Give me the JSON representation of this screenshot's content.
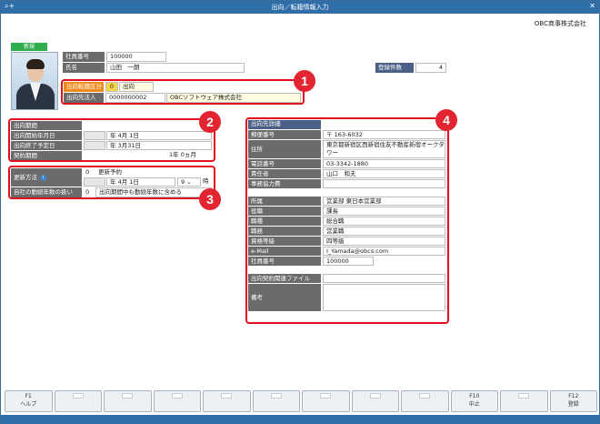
{
  "window": {
    "title": "出向／転籍情報入力",
    "company": "OBC商事株式会社"
  },
  "employee": {
    "badge": "新規",
    "id_label": "社員番号",
    "id_value": "100000",
    "name_label": "氏名",
    "name_value": "山田　一朗"
  },
  "registered": {
    "label": "登録件数",
    "value": "4"
  },
  "section1": {
    "type_label": "出向転籍区分",
    "type_code": "0",
    "type_value": "出向",
    "dest_label": "出向先法人",
    "dest_code": "0000000002",
    "dest_name": "OBCソフトウェア株式会社"
  },
  "section2": {
    "period_label": "出向期間",
    "start_label": "出向開始年月日",
    "start_value": "年  4月  1日",
    "end_label": "出向終了予定日",
    "end_value": "年  3月31日",
    "contract_label": "契約期間",
    "contract_value": "1年  0ヵ月"
  },
  "section3": {
    "renew_label": "更新方法",
    "renew_code": "0",
    "renew_value": "更新予約",
    "renew_date": "年  4月  1日",
    "renew_hour": "9",
    "hour_suffix": "時",
    "service_label": "自社の勤続年数の扱い",
    "service_code": "0",
    "service_value": "出向期間中も勤続年数に含める"
  },
  "section4": {
    "header": "出向先詳細",
    "rows": [
      {
        "label": "郵便番号",
        "value": "〒   163-6032"
      },
      {
        "label": "住所",
        "value": "東京都新宿区西新宿住友不動産新宿オークタワー"
      },
      {
        "label": "電話番号",
        "value": "03-3342-1880"
      },
      {
        "label": "責任者",
        "value": "山口　和夫"
      },
      {
        "label": "事務協力費",
        "value": ""
      },
      {
        "label": "所属",
        "value": "営業部 東日本営業部"
      },
      {
        "label": "役職",
        "value": "課長"
      },
      {
        "label": "職種",
        "value": "総合職"
      },
      {
        "label": "職務",
        "value": "営業職"
      },
      {
        "label": "資格等級",
        "value": "四等級"
      },
      {
        "label": "e-Mail",
        "value": "I_Yamada@obcs.com"
      },
      {
        "label": "社員番号",
        "value": "100000"
      },
      {
        "label": "出向契約関連ファイル",
        "value": ""
      },
      {
        "label": "備考",
        "value": ""
      }
    ]
  },
  "callouts": [
    "1",
    "2",
    "3",
    "4"
  ],
  "fkeys": [
    {
      "key": "F1",
      "label": "ヘルプ"
    },
    {
      "key": "",
      "label": ""
    },
    {
      "key": "",
      "label": ""
    },
    {
      "key": "",
      "label": ""
    },
    {
      "key": "",
      "label": ""
    },
    {
      "key": "",
      "label": ""
    },
    {
      "key": "",
      "label": ""
    },
    {
      "key": "",
      "label": ""
    },
    {
      "key": "",
      "label": ""
    },
    {
      "key": "F10",
      "label": "中止"
    },
    {
      "key": "",
      "label": ""
    },
    {
      "key": "F12",
      "label": "登録"
    }
  ],
  "icons": {
    "titlebar_left": "search-plus-icon",
    "titlebar_right": "close-icon"
  }
}
